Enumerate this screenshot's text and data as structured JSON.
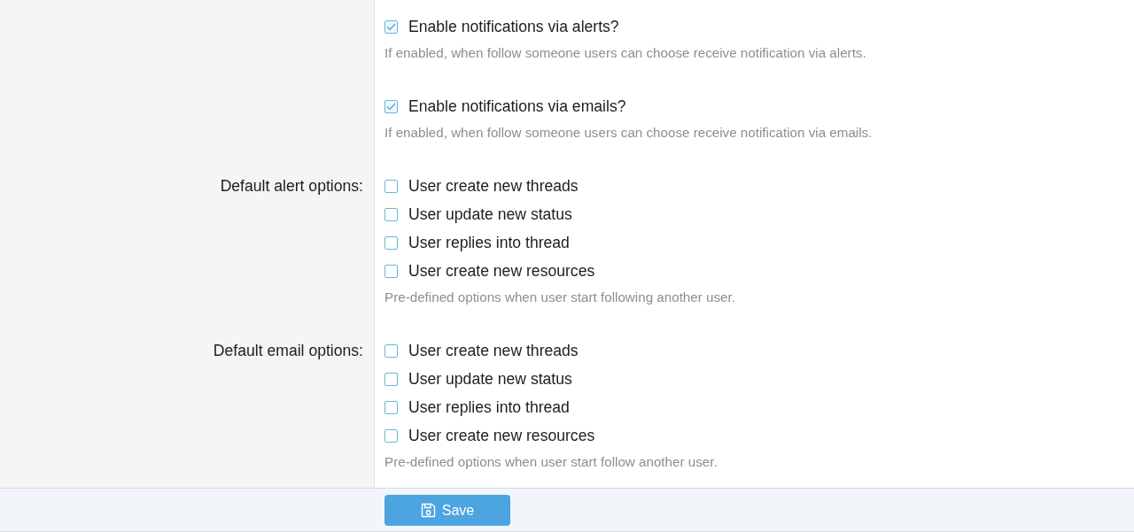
{
  "rows": [
    {
      "options": [
        {
          "label": "Enable notifications via alerts?",
          "checked": true
        }
      ],
      "hint": "If enabled, when follow someone users can choose receive notification via alerts."
    },
    {
      "options": [
        {
          "label": "Enable notifications via emails?",
          "checked": true
        }
      ],
      "hint": "If enabled, when follow someone users can choose receive notification via emails."
    },
    {
      "label": "Default alert options:",
      "options": [
        {
          "label": "User create new threads",
          "checked": false
        },
        {
          "label": "User update new status",
          "checked": false
        },
        {
          "label": "User replies into thread",
          "checked": false
        },
        {
          "label": "User create new resources",
          "checked": false
        }
      ],
      "hint": "Pre-defined options when user start following another user."
    },
    {
      "label": "Default email options:",
      "options": [
        {
          "label": "User create new threads",
          "checked": false
        },
        {
          "label": "User update new status",
          "checked": false
        },
        {
          "label": "User replies into thread",
          "checked": false
        },
        {
          "label": "User create new resources",
          "checked": false
        }
      ],
      "hint": "Pre-defined options when user start follow another user."
    }
  ],
  "footer": {
    "save_button": {
      "label": "Save"
    }
  }
}
